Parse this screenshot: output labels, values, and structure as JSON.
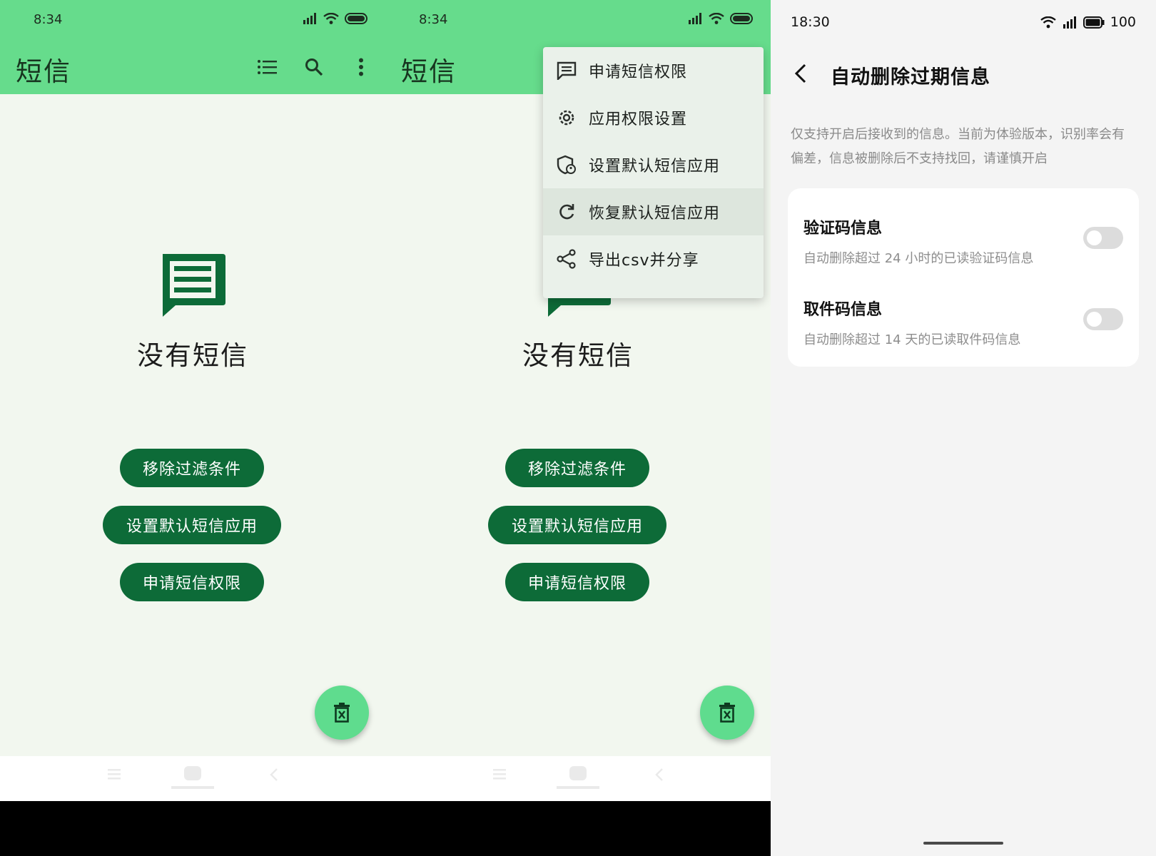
{
  "screen1": {
    "status_time": "8:34",
    "app_title": "短信",
    "toolbar_icons": [
      "list-icon",
      "search-icon",
      "more-vert-icon"
    ],
    "empty_text": "没有短信",
    "buttons": [
      "移除过滤条件",
      "设置默认短信应用",
      "申请短信权限"
    ],
    "fab_icon": "delete-icon"
  },
  "screen2": {
    "status_time": "8:34",
    "app_title": "短信",
    "empty_text": "没有短信",
    "menu": [
      {
        "label": "申请短信权限",
        "icon": "message-icon"
      },
      {
        "label": "应用权限设置",
        "icon": "gear-icon"
      },
      {
        "label": "设置默认短信应用",
        "icon": "shield-icon"
      },
      {
        "label": "恢复默认短信应用",
        "icon": "refresh-icon"
      },
      {
        "label": "导出csv并分享",
        "icon": "share-icon"
      }
    ],
    "buttons": [
      "移除过滤条件",
      "设置默认短信应用",
      "申请短信权限"
    ],
    "fab_icon": "delete-icon"
  },
  "screen3": {
    "status_time": "18:30",
    "battery": "100",
    "title": "自动删除过期信息",
    "description": "仅支持开启后接收到的信息。当前为体验版本，识别率会有偏差，信息被删除后不支持找回，请谨慎开启",
    "settings": [
      {
        "title": "验证码信息",
        "subtitle": "自动删除超过 24 小时的已读验证码信息",
        "enabled": false
      },
      {
        "title": "取件码信息",
        "subtitle": "自动删除超过 14 天的已读取件码信息",
        "enabled": false
      }
    ]
  },
  "colors": {
    "appbar": "#66dc8c",
    "background": "#f2f7ef",
    "button": "#0d6b38",
    "fab": "#5fdc8e",
    "menu": "#eaf1ea"
  }
}
